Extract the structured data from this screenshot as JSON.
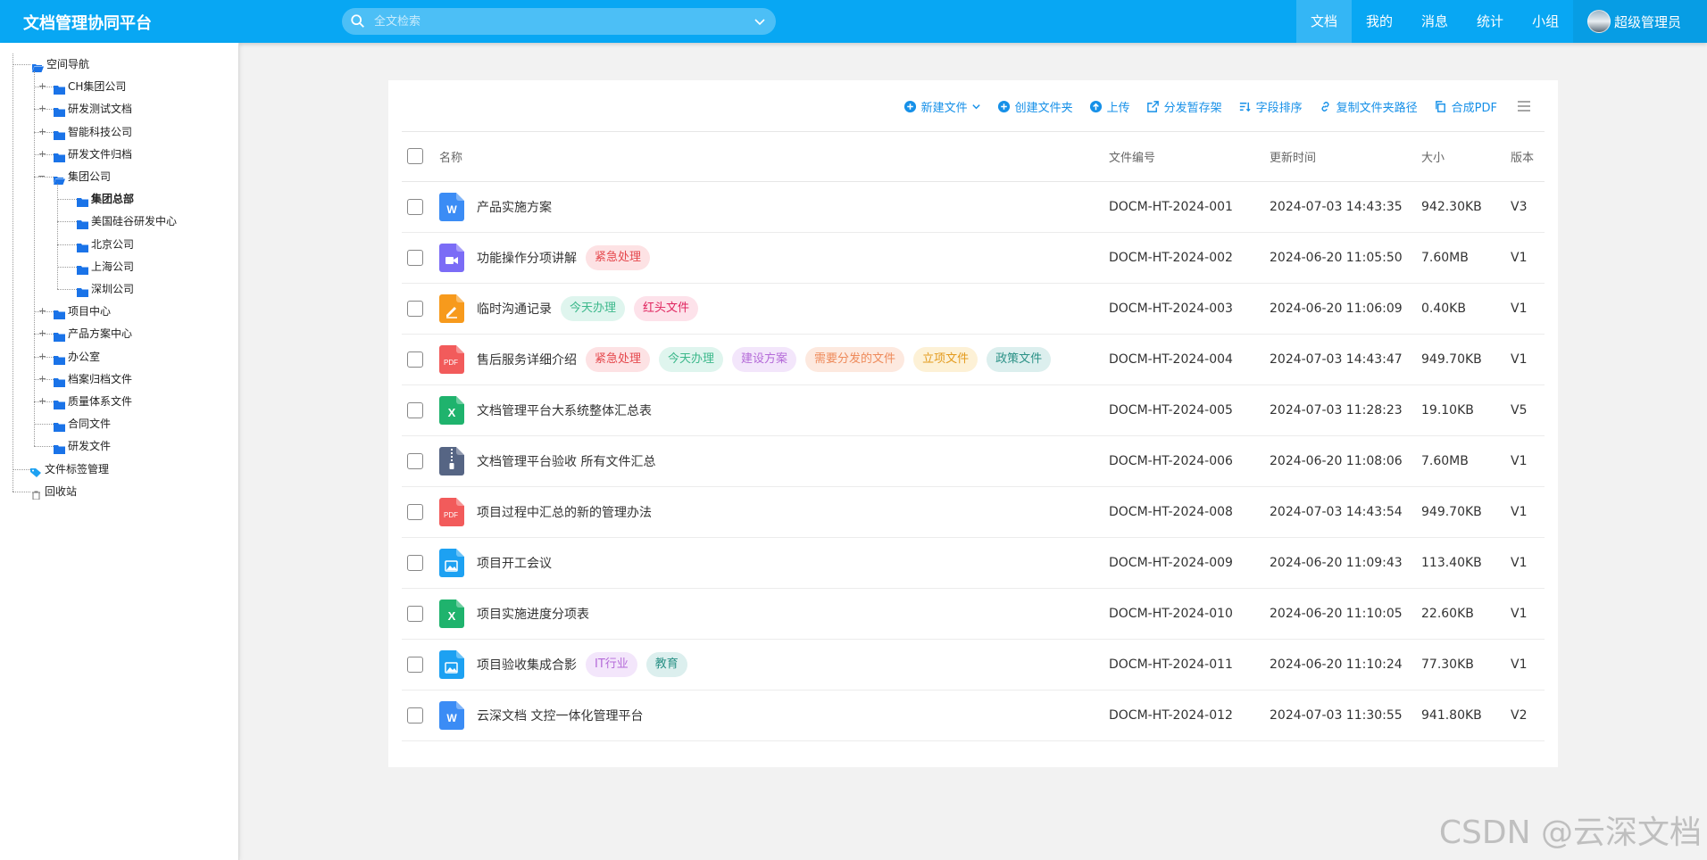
{
  "app": {
    "title": "文档管理协同平台"
  },
  "search": {
    "placeholder": "全文检索"
  },
  "nav": {
    "items": [
      {
        "label": "文档",
        "active": true
      },
      {
        "label": "我的",
        "active": false
      },
      {
        "label": "消息",
        "active": false
      },
      {
        "label": "统计",
        "active": false
      },
      {
        "label": "小组",
        "active": false
      }
    ],
    "user": "超级管理员"
  },
  "sidebar": {
    "root": "空间导航",
    "companies": [
      "CH集团公司",
      "研发测试文档",
      "智能科技公司",
      "研发文件归档"
    ],
    "group": {
      "label": "集团公司",
      "children": [
        "集团总部",
        "美国硅谷研发中心",
        "北京公司",
        "上海公司",
        "深圳公司"
      ]
    },
    "others": [
      "项目中心",
      "产品方案中心",
      "办公室",
      "档案归档文件",
      "质量体系文件",
      "合同文件",
      "研发文件"
    ],
    "tag_manage": "文件标签管理",
    "recycle": "回收站"
  },
  "toolbar": {
    "new_file": "新建文件",
    "create_folder": "创建文件夹",
    "upload": "上传",
    "distribute": "分发暂存架",
    "field_sort": "字段排序",
    "copy_path": "复制文件夹路径",
    "merge_pdf": "合成PDF"
  },
  "table": {
    "headers": {
      "name": "名称",
      "code": "文件编号",
      "updated": "更新时间",
      "size": "大小",
      "version": "版本"
    },
    "rows": [
      {
        "icon": "word",
        "name": "产品实施方案",
        "tags": [],
        "code": "DOCM-HT-2024-001",
        "updated": "2024-07-03 14:43:35",
        "size": "942.30KB",
        "version": "V3"
      },
      {
        "icon": "video",
        "name": "功能操作分项讲解",
        "tags": [
          "紧急处理"
        ],
        "code": "DOCM-HT-2024-002",
        "updated": "2024-06-20 11:05:50",
        "size": "7.60MB",
        "version": "V1"
      },
      {
        "icon": "note",
        "name": "临时沟通记录",
        "tags": [
          "今天办理",
          "红头文件"
        ],
        "code": "DOCM-HT-2024-003",
        "updated": "2024-06-20 11:06:09",
        "size": "0.40KB",
        "version": "V1"
      },
      {
        "icon": "pdf",
        "name": "售后服务详细介绍",
        "tags": [
          "紧急处理",
          "今天办理",
          "建设方案",
          "需要分发的文件",
          "立项文件",
          "政策文件"
        ],
        "code": "DOCM-HT-2024-004",
        "updated": "2024-07-03 14:43:47",
        "size": "949.70KB",
        "version": "V1"
      },
      {
        "icon": "excel",
        "name": "文档管理平台大系统整体汇总表",
        "tags": [],
        "code": "DOCM-HT-2024-005",
        "updated": "2024-07-03 11:28:23",
        "size": "19.10KB",
        "version": "V5"
      },
      {
        "icon": "zip",
        "name": "文档管理平台验收 所有文件汇总",
        "tags": [],
        "code": "DOCM-HT-2024-006",
        "updated": "2024-06-20 11:08:06",
        "size": "7.60MB",
        "version": "V1"
      },
      {
        "icon": "pdf",
        "name": "项目过程中汇总的新的管理办法",
        "tags": [],
        "code": "DOCM-HT-2024-008",
        "updated": "2024-07-03 14:43:54",
        "size": "949.70KB",
        "version": "V1"
      },
      {
        "icon": "image",
        "name": "项目开工会议",
        "tags": [],
        "code": "DOCM-HT-2024-009",
        "updated": "2024-06-20 11:09:43",
        "size": "113.40KB",
        "version": "V1"
      },
      {
        "icon": "excel",
        "name": "项目实施进度分项表",
        "tags": [],
        "code": "DOCM-HT-2024-010",
        "updated": "2024-06-20 11:10:05",
        "size": "22.60KB",
        "version": "V1"
      },
      {
        "icon": "image",
        "name": "项目验收集成合影",
        "tags": [
          "IT行业",
          "教育"
        ],
        "code": "DOCM-HT-2024-011",
        "updated": "2024-06-20 11:10:24",
        "size": "77.30KB",
        "version": "V1"
      },
      {
        "icon": "word",
        "name": "云深文档 文控一体化管理平台",
        "tags": [],
        "code": "DOCM-HT-2024-012",
        "updated": "2024-07-03 11:30:55",
        "size": "941.80KB",
        "version": "V2"
      }
    ]
  },
  "tag_colors": {
    "紧急处理": {
      "bg": "#fde2e4",
      "fg": "#e5484d"
    },
    "今天办理": {
      "bg": "#dff5ee",
      "fg": "#3cb88b"
    },
    "红头文件": {
      "bg": "#fde2ea",
      "fg": "#e0245e"
    },
    "建设方案": {
      "bg": "#f3e6fb",
      "fg": "#b46ad8"
    },
    "需要分发的文件": {
      "bg": "#fde9df",
      "fg": "#ee8a5a"
    },
    "立项文件": {
      "bg": "#fdf1d6",
      "fg": "#e39a1c"
    },
    "政策文件": {
      "bg": "#dcefee",
      "fg": "#2a9186"
    },
    "IT行业": {
      "bg": "#f3e6fb",
      "fg": "#b46ad8"
    },
    "教育": {
      "bg": "#dcefee",
      "fg": "#2a9186"
    }
  },
  "icon_colors": {
    "word": "#3b8cf5",
    "video": "#7b6cf6",
    "note": "#f79a1c",
    "pdf": "#f25b5b",
    "excel": "#1fb36d",
    "zip": "#566584",
    "image": "#1da1f2"
  },
  "watermark": "CSDN @云深文档"
}
